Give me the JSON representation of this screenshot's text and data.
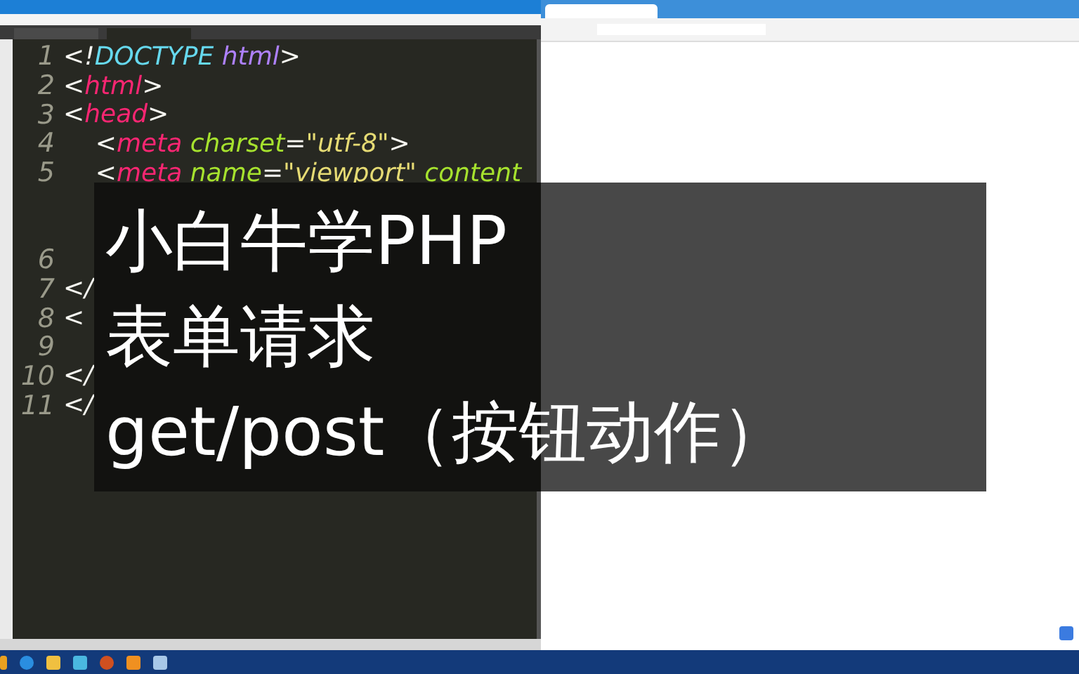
{
  "editor": {
    "lines": [
      {
        "number": "1",
        "tokens": [
          {
            "text": "<!",
            "kind": "punct"
          },
          {
            "text": "DOCTYPE",
            "kind": "doctype"
          },
          {
            "text": " html",
            "kind": "keyword"
          },
          {
            "text": ">",
            "kind": "punct"
          }
        ]
      },
      {
        "number": "2",
        "tokens": [
          {
            "text": "<",
            "kind": "punct"
          },
          {
            "text": "html",
            "kind": "tag"
          },
          {
            "text": ">",
            "kind": "punct"
          }
        ]
      },
      {
        "number": "3",
        "tokens": [
          {
            "text": "<",
            "kind": "punct"
          },
          {
            "text": "head",
            "kind": "tag"
          },
          {
            "text": ">",
            "kind": "punct"
          }
        ]
      },
      {
        "number": "4",
        "tokens": [
          {
            "text": "    <",
            "kind": "punct"
          },
          {
            "text": "meta",
            "kind": "tag"
          },
          {
            "text": " charset",
            "kind": "attr"
          },
          {
            "text": "=",
            "kind": "punct"
          },
          {
            "text": "\"utf-8\"",
            "kind": "string"
          },
          {
            "text": ">",
            "kind": "punct"
          }
        ]
      },
      {
        "number": "5",
        "tokens": [
          {
            "text": "    <",
            "kind": "punct"
          },
          {
            "text": "meta",
            "kind": "tag"
          },
          {
            "text": " name",
            "kind": "attr"
          },
          {
            "text": "=",
            "kind": "punct"
          },
          {
            "text": "\"viewport\"",
            "kind": "string"
          },
          {
            "text": " content",
            "kind": "attr"
          }
        ]
      },
      {
        "number": "6"
      },
      {
        "number": "7",
        "tokens": [
          {
            "text": "</",
            "kind": "punct"
          }
        ]
      },
      {
        "number": "8",
        "tokens": [
          {
            "text": "<",
            "kind": "punct"
          }
        ]
      },
      {
        "number": "9"
      },
      {
        "number": "10",
        "tokens": [
          {
            "text": "</",
            "kind": "punct"
          }
        ]
      },
      {
        "number": "11",
        "tokens": [
          {
            "text": "</",
            "kind": "punct"
          }
        ]
      }
    ]
  },
  "overlay": {
    "lines": [
      "小白牛学PHP",
      "表单请求",
      "get/post（按钮动作）"
    ]
  }
}
